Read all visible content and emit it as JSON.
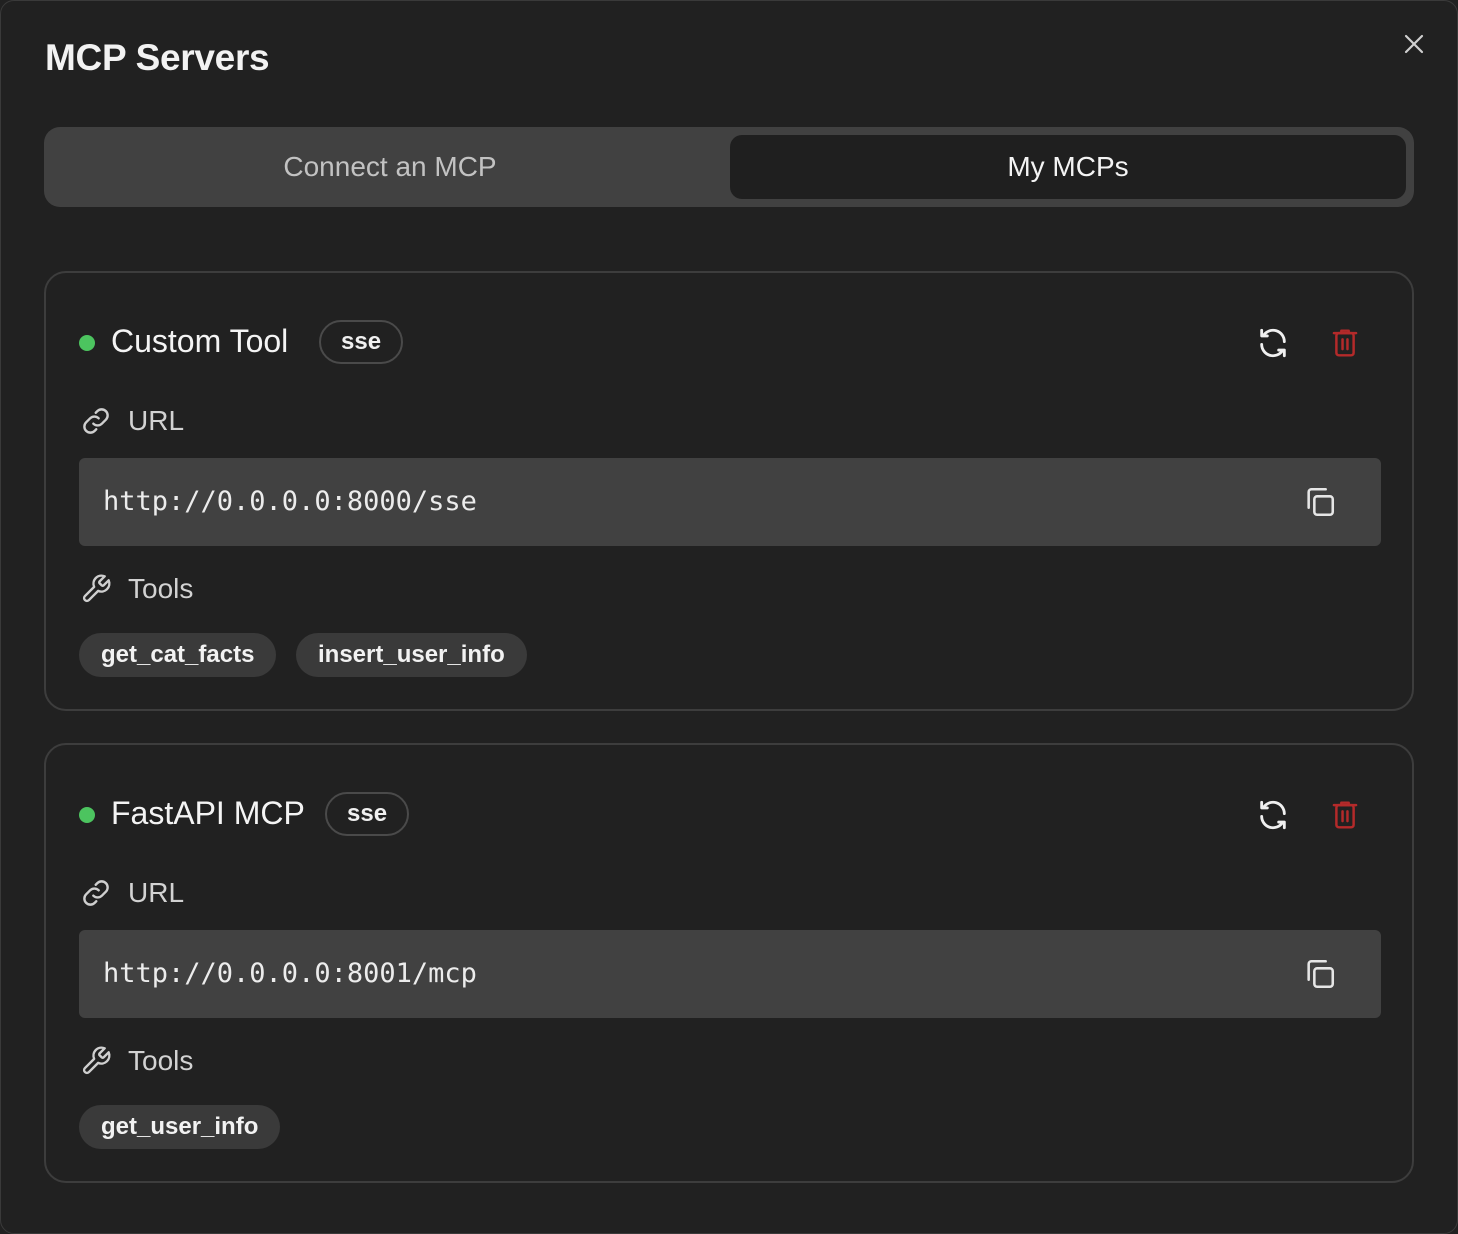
{
  "dialog": {
    "title": "MCP Servers"
  },
  "tabs": [
    {
      "label": "Connect an MCP",
      "active": false
    },
    {
      "label": "My MCPs",
      "active": true
    }
  ],
  "servers": [
    {
      "name": "Custom Tool",
      "transport": "sse",
      "status_color": "#4cc45f",
      "url_label": "URL",
      "url": "http://0.0.0.0:8000/sse",
      "tools_label": "Tools",
      "tools": [
        "get_cat_facts",
        "insert_user_info"
      ]
    },
    {
      "name": "FastAPI MCP",
      "transport": "sse",
      "status_color": "#4cc45f",
      "url_label": "URL",
      "url": "http://0.0.0.0:8001/mcp",
      "tools_label": "Tools",
      "tools": [
        "get_user_info"
      ]
    }
  ],
  "icons": {
    "close": "close-icon",
    "refresh": "refresh-icon",
    "delete": "trash-icon",
    "link": "link-icon",
    "tools": "wrench-icon",
    "copy": "copy-icon"
  },
  "colors": {
    "background": "#212121",
    "active_tab": "#1f1f1f",
    "tab_track": "#414141",
    "delete": "#b42a2a",
    "status_online": "#4cc45f"
  }
}
